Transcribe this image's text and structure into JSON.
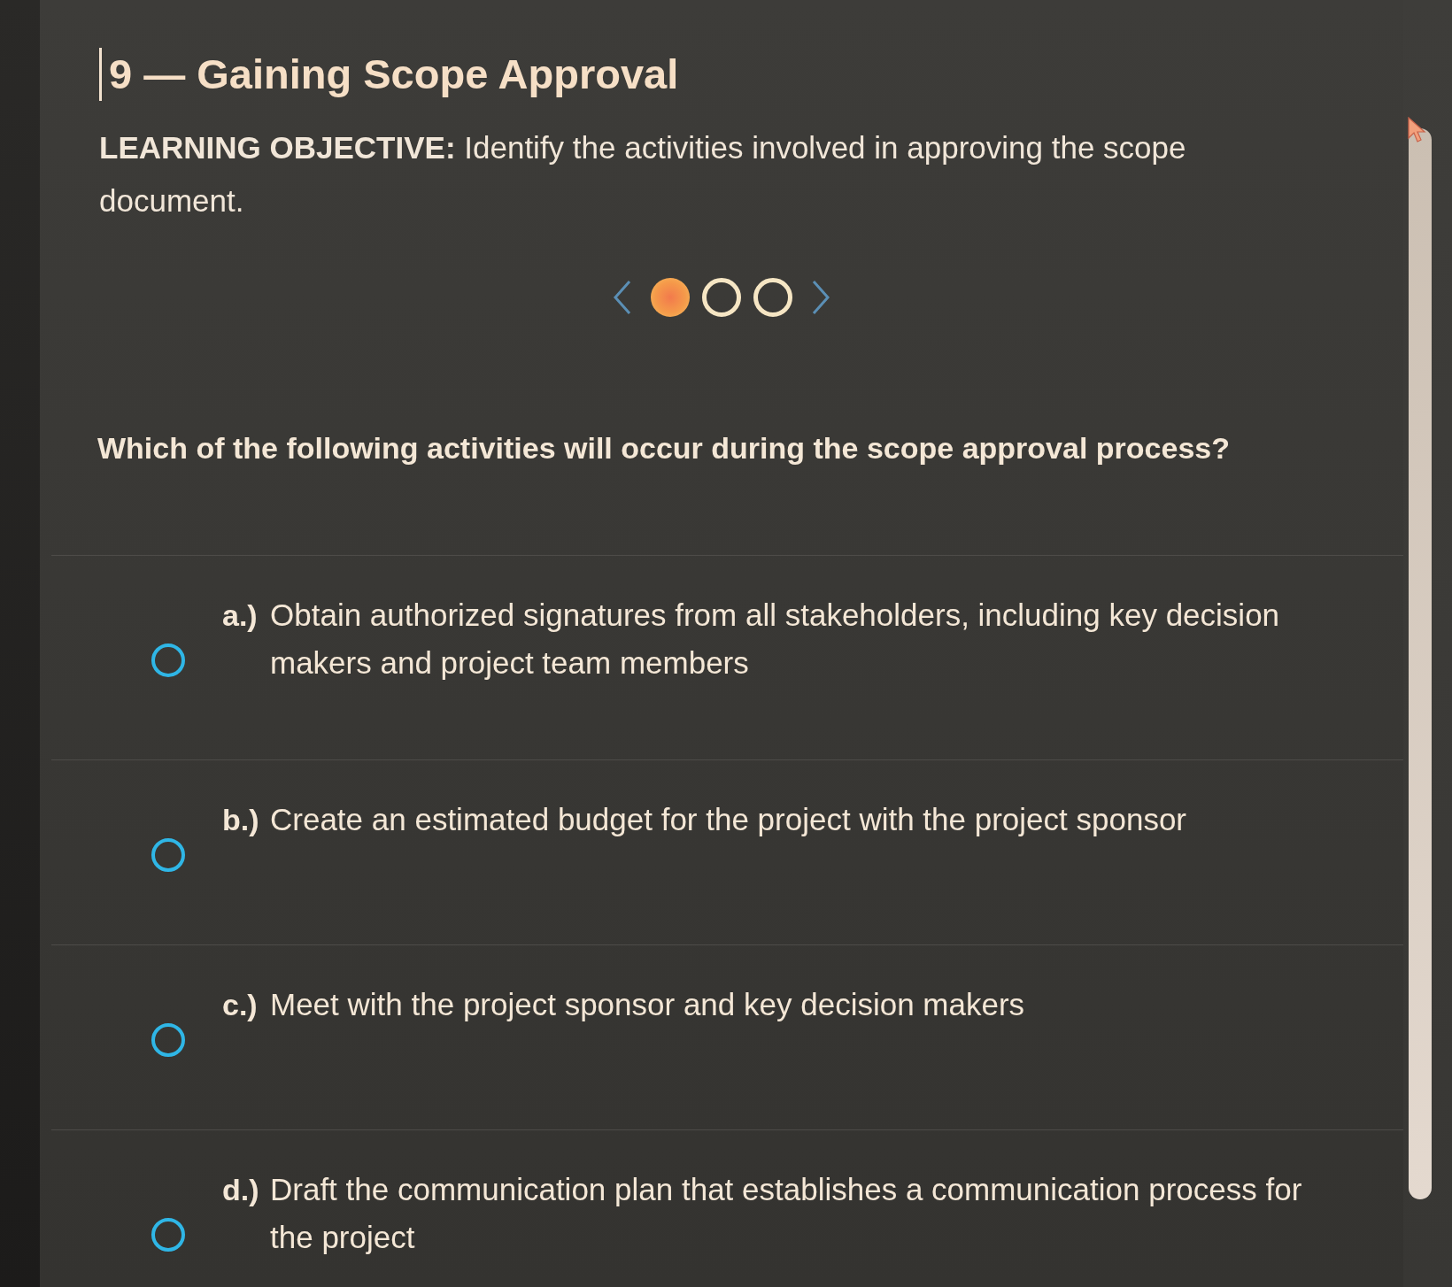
{
  "lesson": {
    "title": "9 — Gaining Scope Approval"
  },
  "objective": {
    "text": "**LEARNING OBJECTIVE:** Identify the activities involved in approving the scope document."
  },
  "pager": {
    "pages": [
      {
        "selected": true
      },
      {
        "selected": false
      },
      {
        "selected": false
      }
    ]
  },
  "question": {
    "text": "Which of the following activities will occur during the scope approval process?"
  },
  "options": [
    {
      "letter": "a.)",
      "text": "Obtain authorized signatures from all stakeholders, including key decision makers and project team members",
      "selected": false
    },
    {
      "letter": "b.)",
      "text": "Create an estimated budget for the project with the project sponsor",
      "selected": false
    },
    {
      "letter": "c.)",
      "text": "Meet with the project sponsor and key decision makers",
      "selected": false
    },
    {
      "letter": "d.)",
      "text": "Draft the communication plan that establishes a communication process for the project",
      "selected": false
    }
  ]
}
